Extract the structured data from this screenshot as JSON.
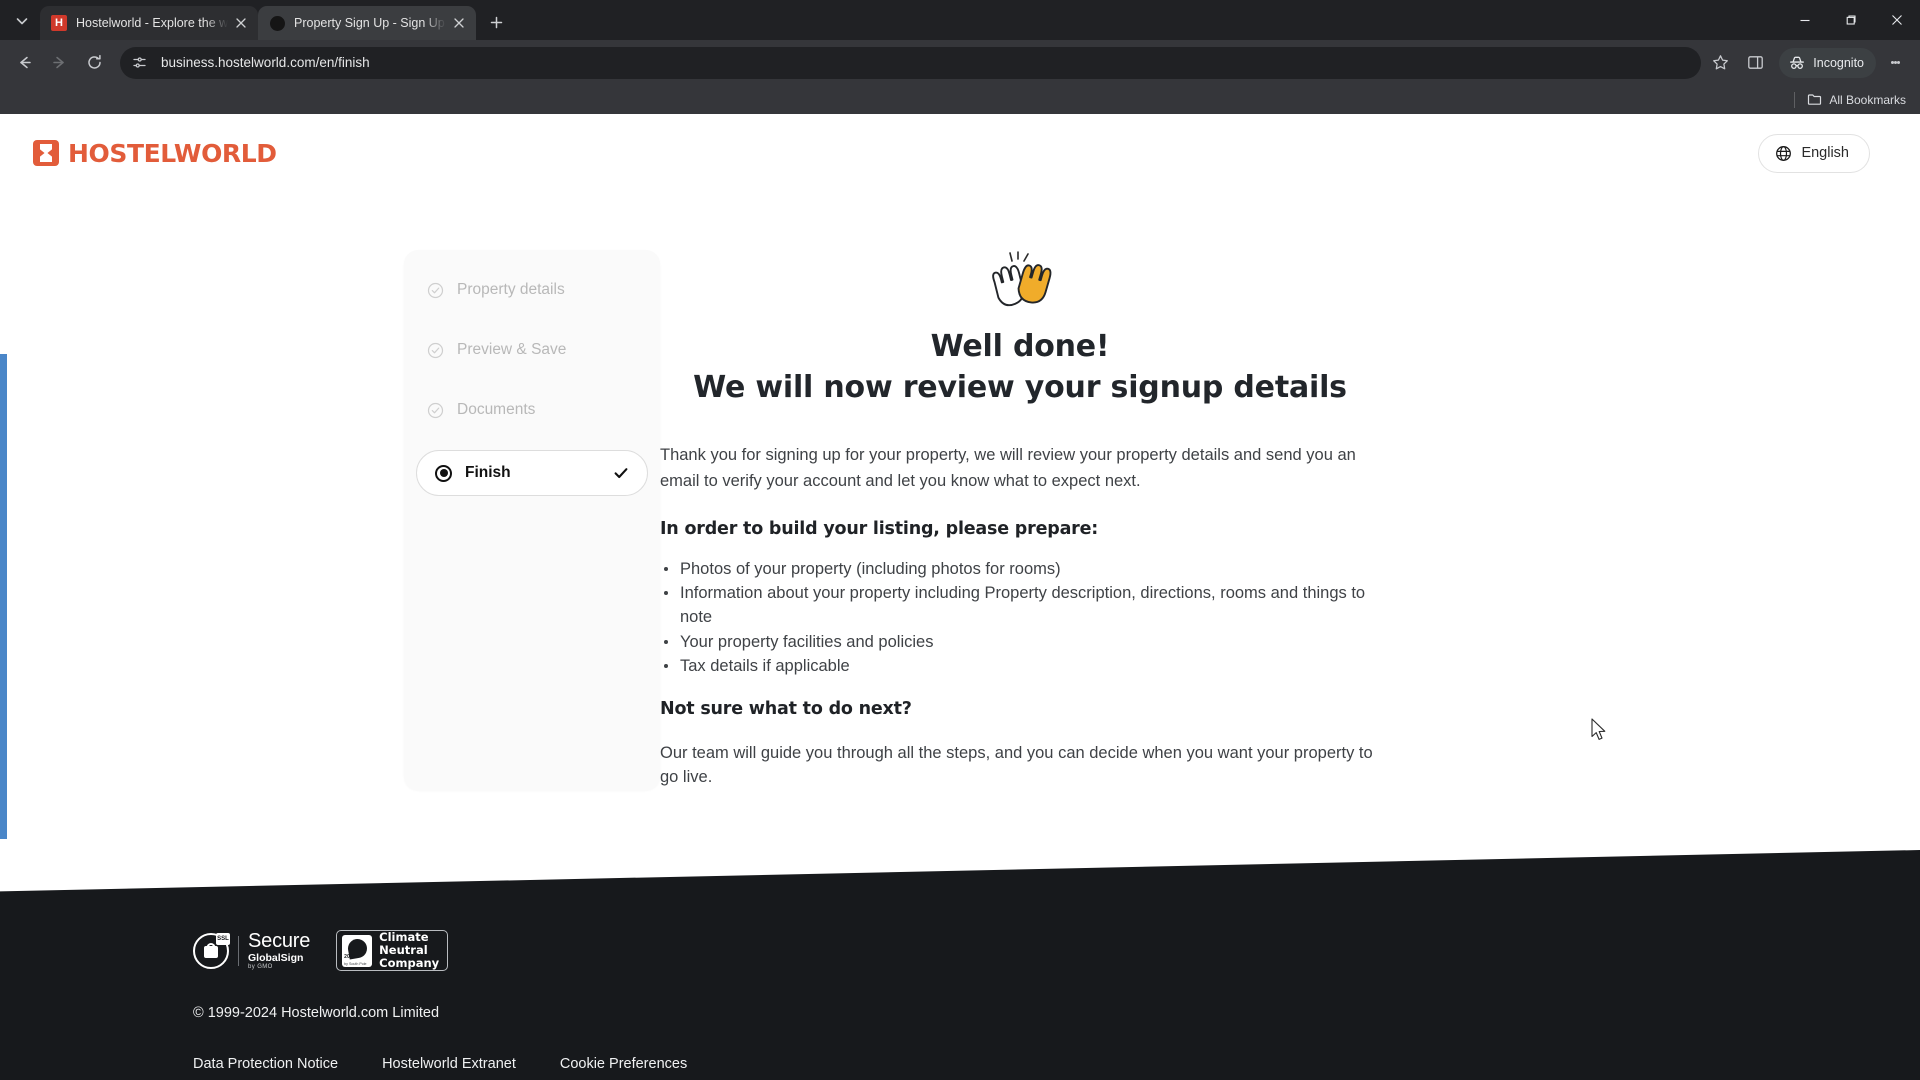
{
  "browser": {
    "tabs": [
      {
        "title": "Hostelworld - Explore the world",
        "favicon": "hostelworld-favicon",
        "active": false
      },
      {
        "title": "Property Sign Up - Sign Up Com",
        "favicon": "dark-circle-favicon",
        "active": true
      }
    ],
    "new_tab_label": "+",
    "url": "business.hostelworld.com/en/finish",
    "profile_chip": "Incognito",
    "bookmarks_label": "All Bookmarks",
    "icons": {
      "tab_search": "chevron-down-icon",
      "back": "back-arrow-icon",
      "forward": "forward-arrow-icon",
      "reload": "reload-icon",
      "site_settings": "tune-sliders-icon",
      "bookmark": "star-icon",
      "side_panel": "side-panel-icon",
      "incognito": "incognito-hat-icon",
      "menu": "three-dot-menu-icon",
      "minimize": "minimize-icon",
      "maximize": "maximize-icon",
      "close": "window-close-icon",
      "bookmarks_folder": "folder-icon"
    }
  },
  "header": {
    "brand": "HOSTELWORLD",
    "language_label": "English",
    "language_icon": "globe-icon",
    "brand_color": "#E25C3A"
  },
  "stepper": {
    "steps": [
      {
        "label": "Property details",
        "state": "completed",
        "icon": "check-circle-icon"
      },
      {
        "label": "Preview & Save",
        "state": "completed",
        "icon": "check-circle-icon"
      },
      {
        "label": "Documents",
        "state": "completed",
        "icon": "check-circle-icon"
      },
      {
        "label": "Finish",
        "state": "current",
        "icon": "radio-filled-icon",
        "trailing_icon": "check-icon"
      }
    ]
  },
  "main": {
    "emoji": "clapping-hands-emoji",
    "headline_line1": "Well done!",
    "headline_line2": "We will now review your signup details",
    "intro": "Thank you for signing up for your property, we will review your property details and send you an email to verify your account and let you know what to expect next.",
    "prepare_heading": "In order to build your listing, please prepare:",
    "prepare_items": [
      "Photos of your property (including photos for rooms)",
      "Information about your property including Property description, directions, rooms and things to note",
      "Your property facilities and policies",
      "Tax details if applicable"
    ],
    "next_heading": "Not sure what to do next?",
    "next_text": "Our team will guide you through all the steps, and you can decide when you want your property to go live."
  },
  "footer": {
    "badges": [
      {
        "name": "globalsign-secure-badge",
        "icon": "padlock-icon",
        "tag": "SSL",
        "line1": "Secure",
        "line2": "GlobalSign",
        "line3": "by GMO"
      },
      {
        "name": "climate-neutral-badge",
        "icon": "climate-swoosh-icon",
        "year": "2023",
        "by": "by South Pole",
        "line1": "Climate",
        "line2": "Neutral",
        "line3": "Company"
      }
    ],
    "copyright": "© 1999-2024 Hostelworld.com Limited",
    "links": [
      "Data Protection Notice",
      "Hostelworld Extranet",
      "Cookie Preferences"
    ],
    "background": "#17191c"
  }
}
